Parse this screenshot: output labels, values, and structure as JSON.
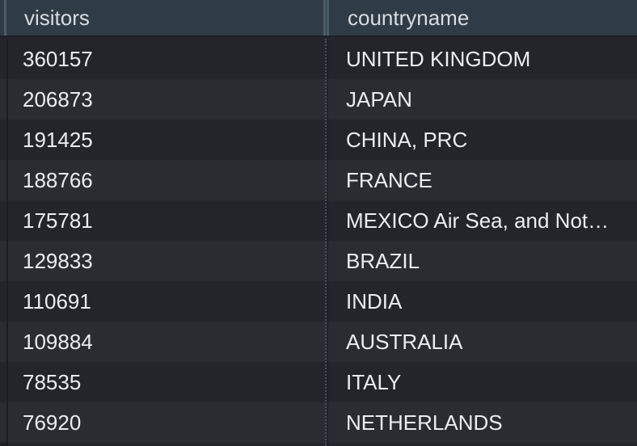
{
  "columns": [
    "visitors",
    "countryname"
  ],
  "rows": [
    {
      "visitors": "360157",
      "countryname": "UNITED KINGDOM"
    },
    {
      "visitors": "206873",
      "countryname": "JAPAN"
    },
    {
      "visitors": "191425",
      "countryname": "CHINA, PRC"
    },
    {
      "visitors": "188766",
      "countryname": "FRANCE"
    },
    {
      "visitors": "175781",
      "countryname": "MEXICO Air Sea, and Not…"
    },
    {
      "visitors": "129833",
      "countryname": "BRAZIL"
    },
    {
      "visitors": "110691",
      "countryname": "INDIA"
    },
    {
      "visitors": "109884",
      "countryname": "AUSTRALIA"
    },
    {
      "visitors": "78535",
      "countryname": "ITALY"
    },
    {
      "visitors": "76920",
      "countryname": "NETHERLANDS"
    }
  ],
  "colors": {
    "header_bg": "#2f3b45",
    "row_odd": "#23252b",
    "row_even": "#2a2c32",
    "text": "#ecedef"
  }
}
